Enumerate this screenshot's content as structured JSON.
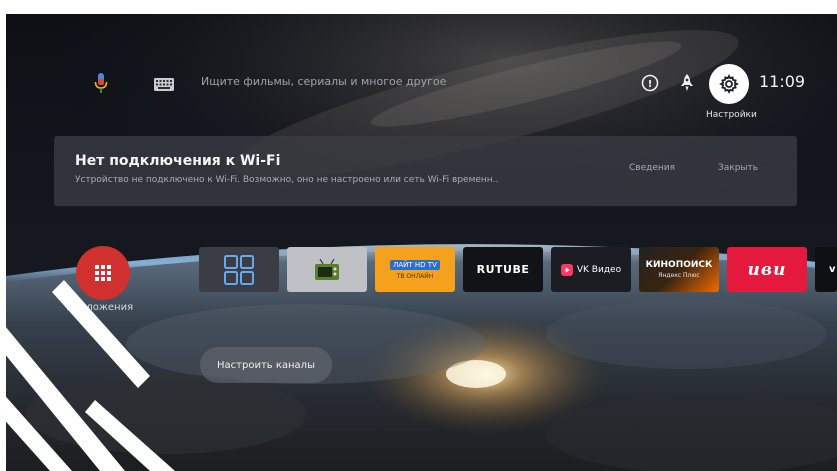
{
  "search": {
    "placeholder": "Ищите фильмы, сериалы и многое другое"
  },
  "top_right": {
    "time": "11:09",
    "settings_label": "Настройки",
    "info_glyph": "!"
  },
  "banner": {
    "title": "Нет подключения к Wi-Fi",
    "subtitle": "Устройство не подключено к Wi-Fi. Возможно, оно не настроено или сеть Wi-Fi временн..",
    "details_label": "Сведения",
    "close_label": "Закрыть"
  },
  "apps": {
    "label": "Приложения"
  },
  "tiles": {
    "lait_label": "ЛАЙТ HD TV",
    "lait_sub": "ТВ ОНЛАЙН",
    "rutube_label": "RUTUBE",
    "vk_label": "VK Видео",
    "kinopoisk_label": "КИНОПОИСК",
    "kinopoisk_sub": "Яндекс Плюс",
    "ivi_label": "иви",
    "partial_label": "v"
  },
  "channels": {
    "setup_label": "Настроить каналы"
  },
  "icons": {
    "mic": "microphone-icon",
    "keyboard": "keyboard-icon",
    "info": "info-circle-icon",
    "rocket": "rocket-icon",
    "settings": "gear-icon",
    "apps": "apps-grid-icon"
  },
  "colors": {
    "accent_red": "#d0302e",
    "ivi_red": "#e5183d",
    "kinopoisk_orange": "#f26b00",
    "vk_pink": "#ff3764"
  }
}
